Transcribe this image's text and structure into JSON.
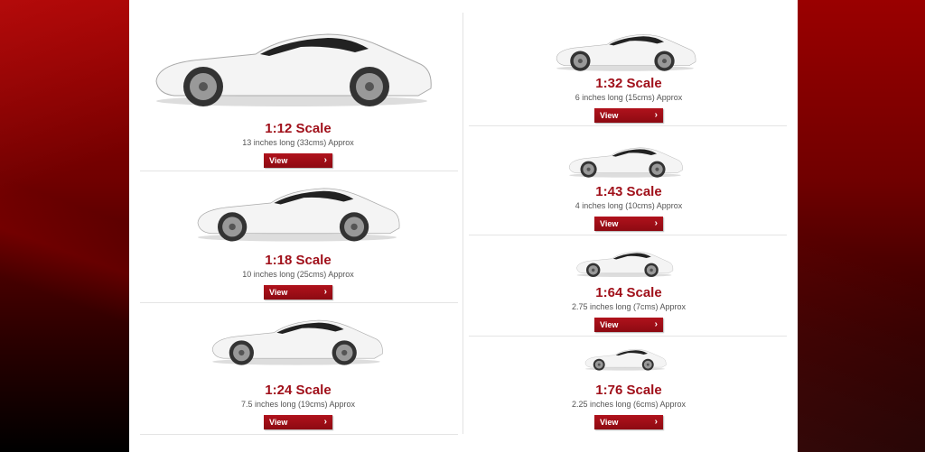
{
  "items": [
    {
      "title": "1:12 Scale",
      "desc": "13 inches long (33cms) Approx",
      "view": "View"
    },
    {
      "title": "1:18 Scale",
      "desc": "10 inches long (25cms) Approx",
      "view": "View"
    },
    {
      "title": "1:24 Scale",
      "desc": "7.5 inches long (19cms) Approx",
      "view": "View"
    },
    {
      "title": "1:32 Scale",
      "desc": "6 inches long (15cms) Approx",
      "view": "View"
    },
    {
      "title": "1:43 Scale",
      "desc": "4 inches long (10cms) Approx",
      "view": "View"
    },
    {
      "title": "1:64 Scale",
      "desc": "2.75 inches long (7cms) Approx",
      "view": "View"
    },
    {
      "title": "1:76 Scale",
      "desc": "2.25 inches long (6cms) Approx",
      "view": "View"
    }
  ],
  "colors": {
    "accent": "#a0101a",
    "button": "#9e0f18",
    "background": "#7a0000"
  },
  "icons": {
    "car": "car-image",
    "chevron": "chevron-right-icon"
  }
}
